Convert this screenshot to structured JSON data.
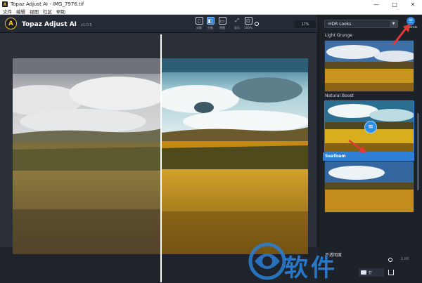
{
  "window": {
    "title": "Topaz Adjust AI - IMG_7976.tif",
    "controls": [
      "—",
      "□",
      "✕"
    ]
  },
  "menu": [
    "文件",
    "编辑",
    "视图",
    "社区",
    "帮助"
  ],
  "toolbar": {
    "app_name": "Topaz Adjust AI",
    "version": "v1.0.5",
    "view_buttons": [
      {
        "label": "对照",
        "icon": "single-view-icon"
      },
      {
        "label": "分割",
        "icon": "split-view-icon",
        "active": true
      },
      {
        "label": "原图",
        "icon": "original-icon"
      },
      {
        "label": "显示",
        "icon": "fit-icon"
      },
      {
        "label": "100%",
        "icon": "actual-size-icon"
      }
    ],
    "zoom_value": "17%"
  },
  "panel": {
    "preset_category": "HDR Looks",
    "controls_label": "Controls",
    "looks": [
      {
        "name": "Light Grunge",
        "selected": false
      },
      {
        "name": "Natural Boost",
        "selected": false
      },
      {
        "name": "Seafoam",
        "selected": true
      },
      {
        "name": "",
        "selected": false
      }
    ]
  },
  "bottom": {
    "opacity_label": "不透明度",
    "opacity_value": "1.00",
    "folder_label": "打",
    "export_label": ""
  },
  "watermark": {
    "text": "软件"
  },
  "colors": {
    "accent": "#2f7fd6",
    "panel_bg": "#1d2229",
    "toolbar_bg": "#252b35",
    "logo_yellow": "#f2c12e",
    "annotation_red": "#e53935"
  }
}
